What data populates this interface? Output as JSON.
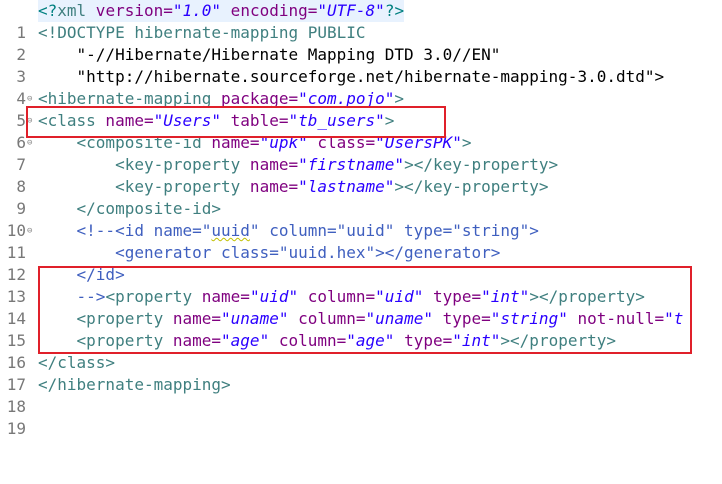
{
  "editor": {
    "line_numbers": [
      "1",
      "2",
      "3",
      "4",
      "5",
      "6",
      "7",
      "8",
      "9",
      "10",
      "11",
      "12",
      "13",
      "14",
      "15",
      "16",
      "17",
      "18",
      "19"
    ],
    "l1": {
      "open": "<?",
      "tag": "xml",
      "a1": " version=",
      "v1": "\"1.0\"",
      "a2": " encoding=",
      "v2": "\"UTF-8\"",
      "close": "?>"
    },
    "l2": {
      "open": "<!DOCTYPE",
      "rest": " hibernate-mapping PUBLIC"
    },
    "l3": {
      "text": "    \"-//Hibernate/Hibernate Mapping DTD 3.0//EN\""
    },
    "l4": {
      "text": "    \"http://hibernate.sourceforge.net/hibernate-mapping-3.0.dtd\">"
    },
    "l5": {
      "tag": "<hibernate-mapping",
      "a1": " package=",
      "v1": "\"com.pojo\"",
      "close": ">"
    },
    "l6": {
      "tag": "<class",
      "a1": " name=",
      "v1": "\"Users\"",
      "a2": " table=",
      "v2": "\"tb_users\"",
      "close": ">"
    },
    "l7": {
      "indent": "    ",
      "tag": "<composite-id",
      "a1": " name=",
      "v1": "\"upk\"",
      "a2": " class=",
      "v2": "\"UsersPK\"",
      "close": ">"
    },
    "l8": {
      "indent": "        ",
      "tag": "<key-property",
      "a1": " name=",
      "v1": "\"firstname\"",
      "close": "></key-property>"
    },
    "l9": {
      "indent": "        ",
      "tag": "<key-property",
      "a1": " name=",
      "v1": "\"lastname\"",
      "close": "></key-property>"
    },
    "l10": {
      "indent": "    ",
      "tag": "</composite-id>"
    },
    "l11": {
      "indent": "    ",
      "c1": "<!--<id name=\"",
      "w1": "uuid",
      "c2": "\" column=\"uuid\" type=\"string\">"
    },
    "l12": {
      "text": "        <generator class=\"uuid.hex\"></generator>"
    },
    "l13": {
      "text": "    </id>"
    },
    "l14": {
      "indent": "    ",
      "com": "-->",
      "tag": "<property",
      "a1": " name=",
      "v1": "\"uid\"",
      "a2": " column=",
      "v2": "\"uid\"",
      "a3": " type=",
      "v3": "\"int\"",
      "close": "></property>"
    },
    "l15": {
      "indent": "    ",
      "tag": "<property",
      "a1": " name=",
      "v1": "\"uname\"",
      "a2": " column=",
      "v2": "\"uname\"",
      "a3": " type=",
      "v3": "\"string\"",
      "a4": " not-null=",
      "v4": "\"t"
    },
    "l16": {
      "indent": "    ",
      "tag": "<property",
      "a1": " name=",
      "v1": "\"age\"",
      "a2": " column=",
      "v2": "\"age\"",
      "a3": " type=",
      "v3": "\"int\"",
      "close": "></property>"
    },
    "l17": {
      "tag": "</class>"
    },
    "l18": {
      "tag": "</hibernate-mapping>"
    },
    "fold_marker": "⊖"
  },
  "colors": {
    "tag": "#3f7f7f",
    "attribute": "#7f007f",
    "value": "#2a00ff",
    "comment": "#3f5fbf",
    "highlight_box": "#e0202a"
  }
}
